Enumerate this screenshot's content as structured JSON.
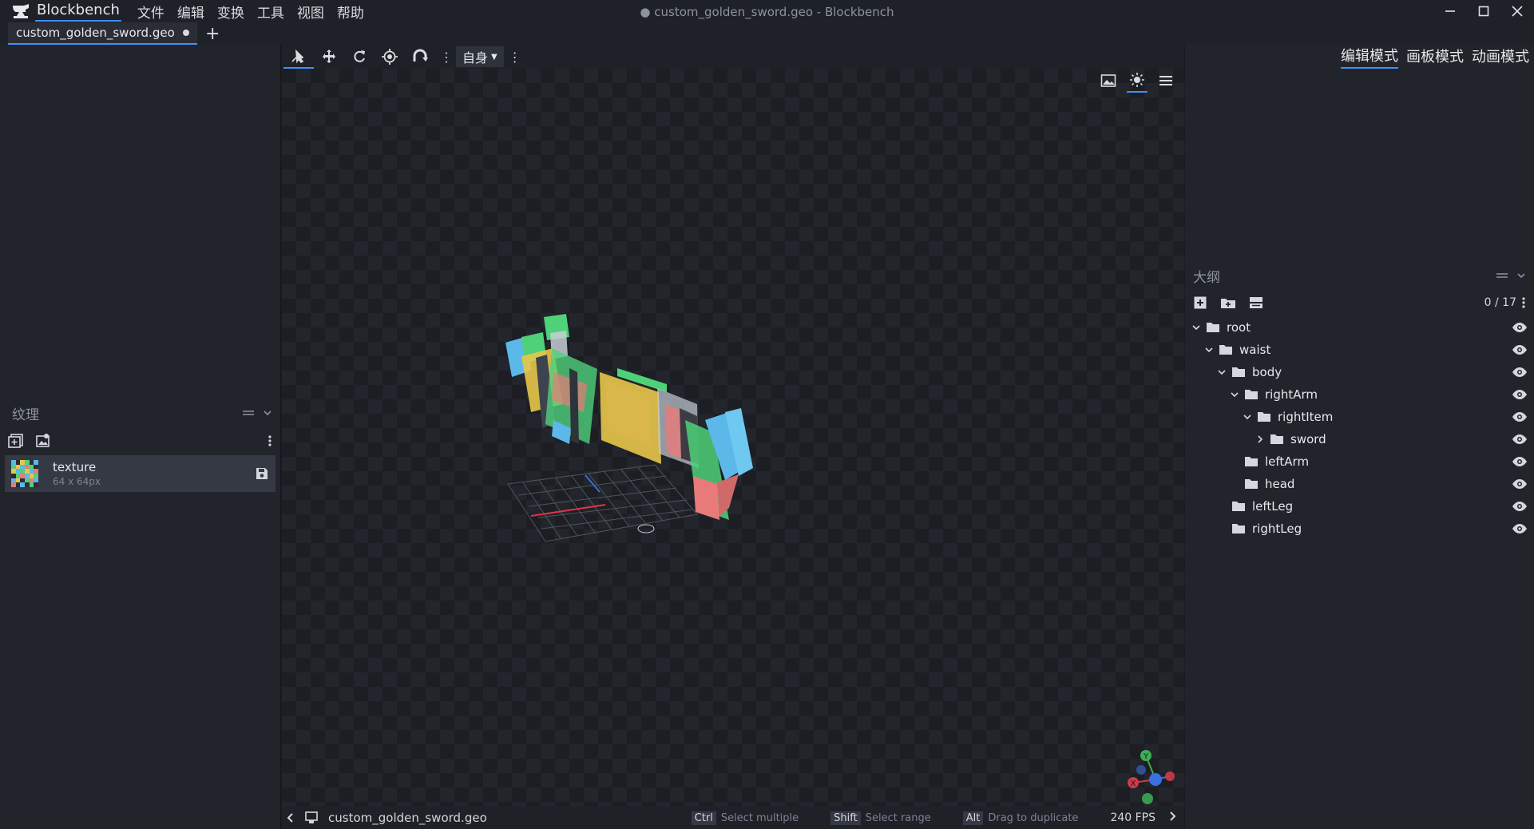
{
  "app": {
    "name": "Blockbench",
    "window_title": "● custom_golden_sword.geo - Blockbench",
    "menu": [
      "文件",
      "编辑",
      "变换",
      "工具",
      "视图",
      "帮助"
    ]
  },
  "tabs": {
    "file_tab": "custom_golden_sword.geo",
    "new_tab": "+"
  },
  "toolbar": {
    "transform_space": "自身"
  },
  "modes": [
    "编辑模式",
    "画板模式",
    "动画模式"
  ],
  "textures_panel": {
    "title": "纹理",
    "items": [
      {
        "name": "texture",
        "size": "64 x 64px"
      }
    ]
  },
  "outliner": {
    "title": "大纲",
    "count": "0 / 17",
    "nodes": [
      {
        "name": "root",
        "expanded": true
      },
      {
        "name": "waist",
        "expanded": true
      },
      {
        "name": "body",
        "expanded": true
      },
      {
        "name": "rightArm",
        "expanded": true
      },
      {
        "name": "rightItem",
        "expanded": true
      },
      {
        "name": "sword",
        "expanded": false
      },
      {
        "name": "leftArm"
      },
      {
        "name": "head"
      },
      {
        "name": "leftLeg"
      },
      {
        "name": "rightLeg"
      }
    ]
  },
  "statusbar": {
    "file": "custom_golden_sword.geo",
    "hints": [
      {
        "key": "Ctrl",
        "label": "Select multiple"
      },
      {
        "key": "Shift",
        "label": "Select range"
      },
      {
        "key": "Alt",
        "label": "Drag to duplicate"
      }
    ],
    "fps": "240 FPS"
  },
  "gizmo": {
    "x": "X",
    "y": "Y"
  },
  "colors": {
    "accent": "#3e90ff",
    "background": "#1a1c21",
    "panel": "#21242b",
    "selected_item": "#353943"
  }
}
